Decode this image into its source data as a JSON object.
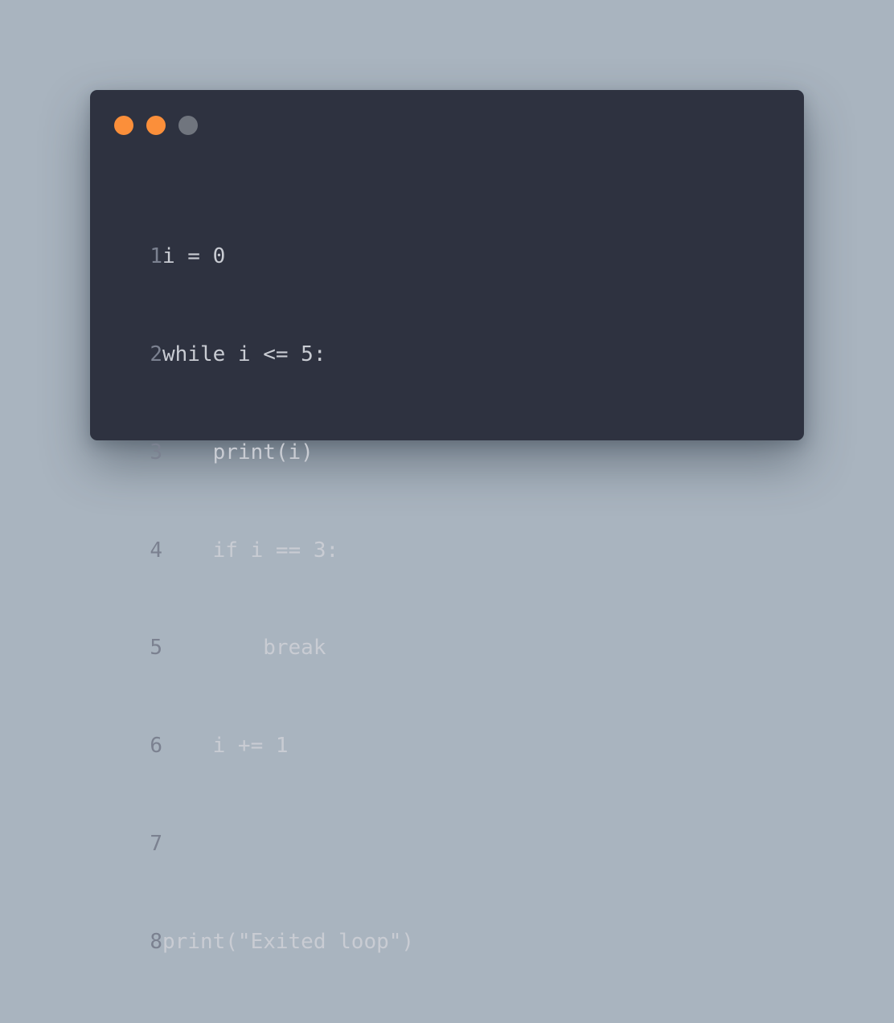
{
  "window": {
    "dot_colors": [
      "#fb8f3a",
      "#fb8f3a",
      "#70757e"
    ]
  },
  "code": {
    "lines": [
      {
        "number": "1",
        "text": "i = 0"
      },
      {
        "number": "2",
        "text": "while i <= 5:"
      },
      {
        "number": "3",
        "text": "    print(i)"
      },
      {
        "number": "4",
        "text": "    if i == 3:"
      },
      {
        "number": "5",
        "text": "        break"
      },
      {
        "number": "6",
        "text": "    i += 1"
      },
      {
        "number": "7",
        "text": ""
      },
      {
        "number": "8",
        "text": "print(\"Exited loop\")"
      }
    ]
  }
}
